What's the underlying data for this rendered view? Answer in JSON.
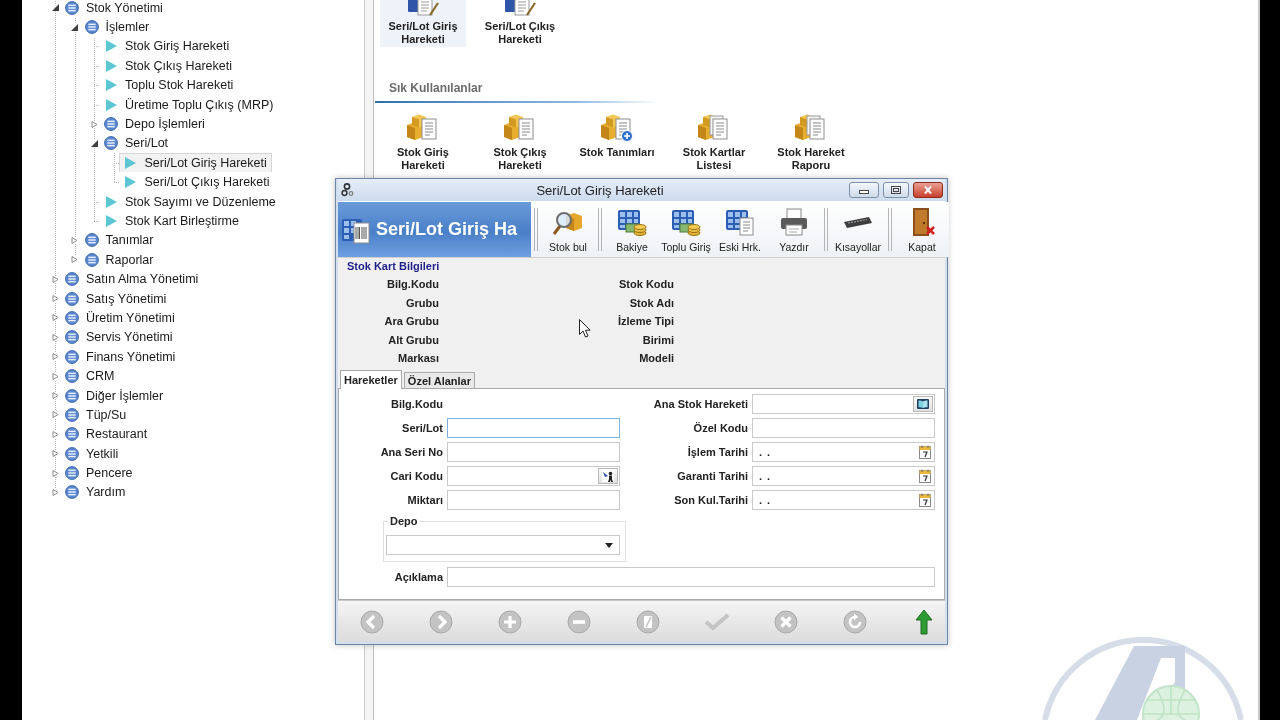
{
  "tree": {
    "items": [
      {
        "label": "Stok Yönetimi",
        "kind": "group",
        "expanded": true,
        "selected": false,
        "children": [
          {
            "label": "İşlemler",
            "kind": "group",
            "expanded": true,
            "selected": false,
            "children": [
              {
                "label": "Stok Giriş Hareketi",
                "kind": "item",
                "selected": false
              },
              {
                "label": "Stok Çıkış Hareketi",
                "kind": "item",
                "selected": false
              },
              {
                "label": "Toplu Stok Hareketi",
                "kind": "item",
                "selected": false
              },
              {
                "label": "Üretime Toplu Çıkış (MRP)",
                "kind": "item",
                "selected": false
              },
              {
                "label": "Depo İşlemleri",
                "kind": "group",
                "expanded": false,
                "selected": false
              },
              {
                "label": "Seri/Lot",
                "kind": "group",
                "expanded": true,
                "selected": false,
                "children": [
                  {
                    "label": "Seri/Lot Giriş Hareketi",
                    "kind": "item",
                    "selected": true
                  },
                  {
                    "label": "Seri/Lot Çıkış Hareketi",
                    "kind": "item",
                    "selected": false
                  }
                ]
              },
              {
                "label": "Stok Sayımı ve Düzenleme",
                "kind": "item",
                "selected": false
              },
              {
                "label": "Stok Kart Birleştirme",
                "kind": "item",
                "selected": false
              }
            ]
          },
          {
            "label": "Tanımlar",
            "kind": "group",
            "expanded": false,
            "selected": false
          },
          {
            "label": "Raporlar",
            "kind": "group",
            "expanded": false,
            "selected": false
          }
        ]
      },
      {
        "label": "Satın Alma Yönetimi",
        "kind": "group",
        "expanded": false,
        "selected": false
      },
      {
        "label": "Satış Yönetimi",
        "kind": "group",
        "expanded": false,
        "selected": false
      },
      {
        "label": "Üretim Yönetimi",
        "kind": "group",
        "expanded": false,
        "selected": false
      },
      {
        "label": "Servis Yönetimi",
        "kind": "group",
        "expanded": false,
        "selected": false
      },
      {
        "label": "Finans Yönetimi",
        "kind": "group",
        "expanded": false,
        "selected": false
      },
      {
        "label": "CRM",
        "kind": "group",
        "expanded": false,
        "selected": false
      },
      {
        "label": "Diğer İşlemler",
        "kind": "group",
        "expanded": false,
        "selected": false
      },
      {
        "label": "Tüp/Su",
        "kind": "group",
        "expanded": false,
        "selected": false
      },
      {
        "label": "Restaurant",
        "kind": "group",
        "expanded": false,
        "selected": false
      },
      {
        "label": "Yetkili",
        "kind": "group",
        "expanded": false,
        "selected": false
      },
      {
        "label": "Pencere",
        "kind": "group",
        "expanded": false,
        "selected": false
      },
      {
        "label": "Yardım",
        "kind": "group",
        "expanded": false,
        "selected": false
      }
    ]
  },
  "launcher": {
    "items": [
      {
        "label": "Seri/Lot Giriş Hareketi",
        "kind": "serial",
        "selected": true
      },
      {
        "label": "Seri/Lot Çıkış Hareketi",
        "kind": "serial",
        "selected": false
      }
    ]
  },
  "favorites": {
    "title": "Sık Kullanılanlar",
    "items": [
      {
        "label": "Stok Giriş Hareketi",
        "kind": "stock",
        "selected": false
      },
      {
        "label": "Stok Çıkış Hareketi",
        "kind": "stock",
        "selected": false
      },
      {
        "label": "Stok Tanımları",
        "kind": "stock-add",
        "selected": false
      },
      {
        "label": "Stok Kartlar Listesi",
        "kind": "stock-list",
        "selected": false
      },
      {
        "label": "Stok Hareket Raporu",
        "kind": "stock-report",
        "selected": false
      }
    ]
  },
  "dialog": {
    "title": "Seri/Lot Giriş Hareketi",
    "header_title": "Seri/Lot Giriş Ha",
    "toolbar": {
      "groups": [
        [
          {
            "label": "Stok bul",
            "kind": "find"
          }
        ],
        [
          {
            "label": "Bakiye",
            "kind": "balance"
          },
          {
            "label": "Toplu Giriş",
            "kind": "bulk"
          },
          {
            "label": "Eski Hrk.",
            "kind": "history"
          },
          {
            "label": "Yazdır",
            "kind": "print"
          }
        ],
        [
          {
            "label": "Kısayollar",
            "kind": "shortcuts"
          }
        ],
        [
          {
            "label": "Kapat",
            "kind": "close"
          }
        ]
      ]
    },
    "info": {
      "title": "Stok Kart Bilgileri",
      "rows": [
        {
          "left": "Bilg.Kodu",
          "right": "Stok Kodu"
        },
        {
          "left": "Grubu",
          "right": "Stok Adı"
        },
        {
          "left": "Ara Grubu",
          "right": "İzleme Tipi"
        },
        {
          "left": "Alt Grubu",
          "right": "Birimi"
        },
        {
          "left": "Markası",
          "right": "Modeli"
        }
      ]
    },
    "tabs": [
      {
        "label": "Hareketler",
        "selected": true
      },
      {
        "label": "Özel Alanlar",
        "selected": false
      }
    ],
    "form": {
      "rows": [
        {
          "left": {
            "label": "Bilg.Kodu",
            "kind": "text"
          },
          "right": {
            "label": "Ana Stok Hareketi",
            "kind": "browse",
            "focused": false
          }
        },
        {
          "left": {
            "label": "Seri/Lot",
            "kind": "input",
            "focused": true
          },
          "right": {
            "label": "Özel Kodu",
            "kind": "input",
            "focused": false
          }
        },
        {
          "left": {
            "label": "Ana Seri No",
            "kind": "input",
            "focused": false
          },
          "right": {
            "label": "İşlem Tarihi",
            "kind": "date",
            "value": ". .",
            "focused": false
          }
        },
        {
          "left": {
            "label": "Cari Kodu",
            "kind": "picker",
            "focused": false
          },
          "right": {
            "label": "Garanti Tarihi",
            "kind": "date",
            "value": ". .",
            "focused": false
          }
        },
        {
          "left": {
            "label": "Miktarı",
            "kind": "input",
            "focused": false
          },
          "right": {
            "label": "Son Kul.Tarihi",
            "kind": "date",
            "value": ". .",
            "focused": false
          }
        }
      ],
      "warehouse": {
        "label": "Depo"
      },
      "description": {
        "label": "Açıklama",
        "focused": false
      }
    },
    "nav": [
      {
        "kind": "back",
        "disabled": true
      },
      {
        "kind": "forward",
        "disabled": true
      },
      {
        "kind": "add",
        "disabled": true
      },
      {
        "kind": "remove",
        "disabled": true
      },
      {
        "kind": "edit",
        "disabled": true
      },
      {
        "kind": "accept",
        "disabled": true
      },
      {
        "kind": "cancel",
        "disabled": true
      },
      {
        "kind": "refresh",
        "disabled": true
      },
      {
        "kind": "up",
        "disabled": false
      }
    ]
  }
}
